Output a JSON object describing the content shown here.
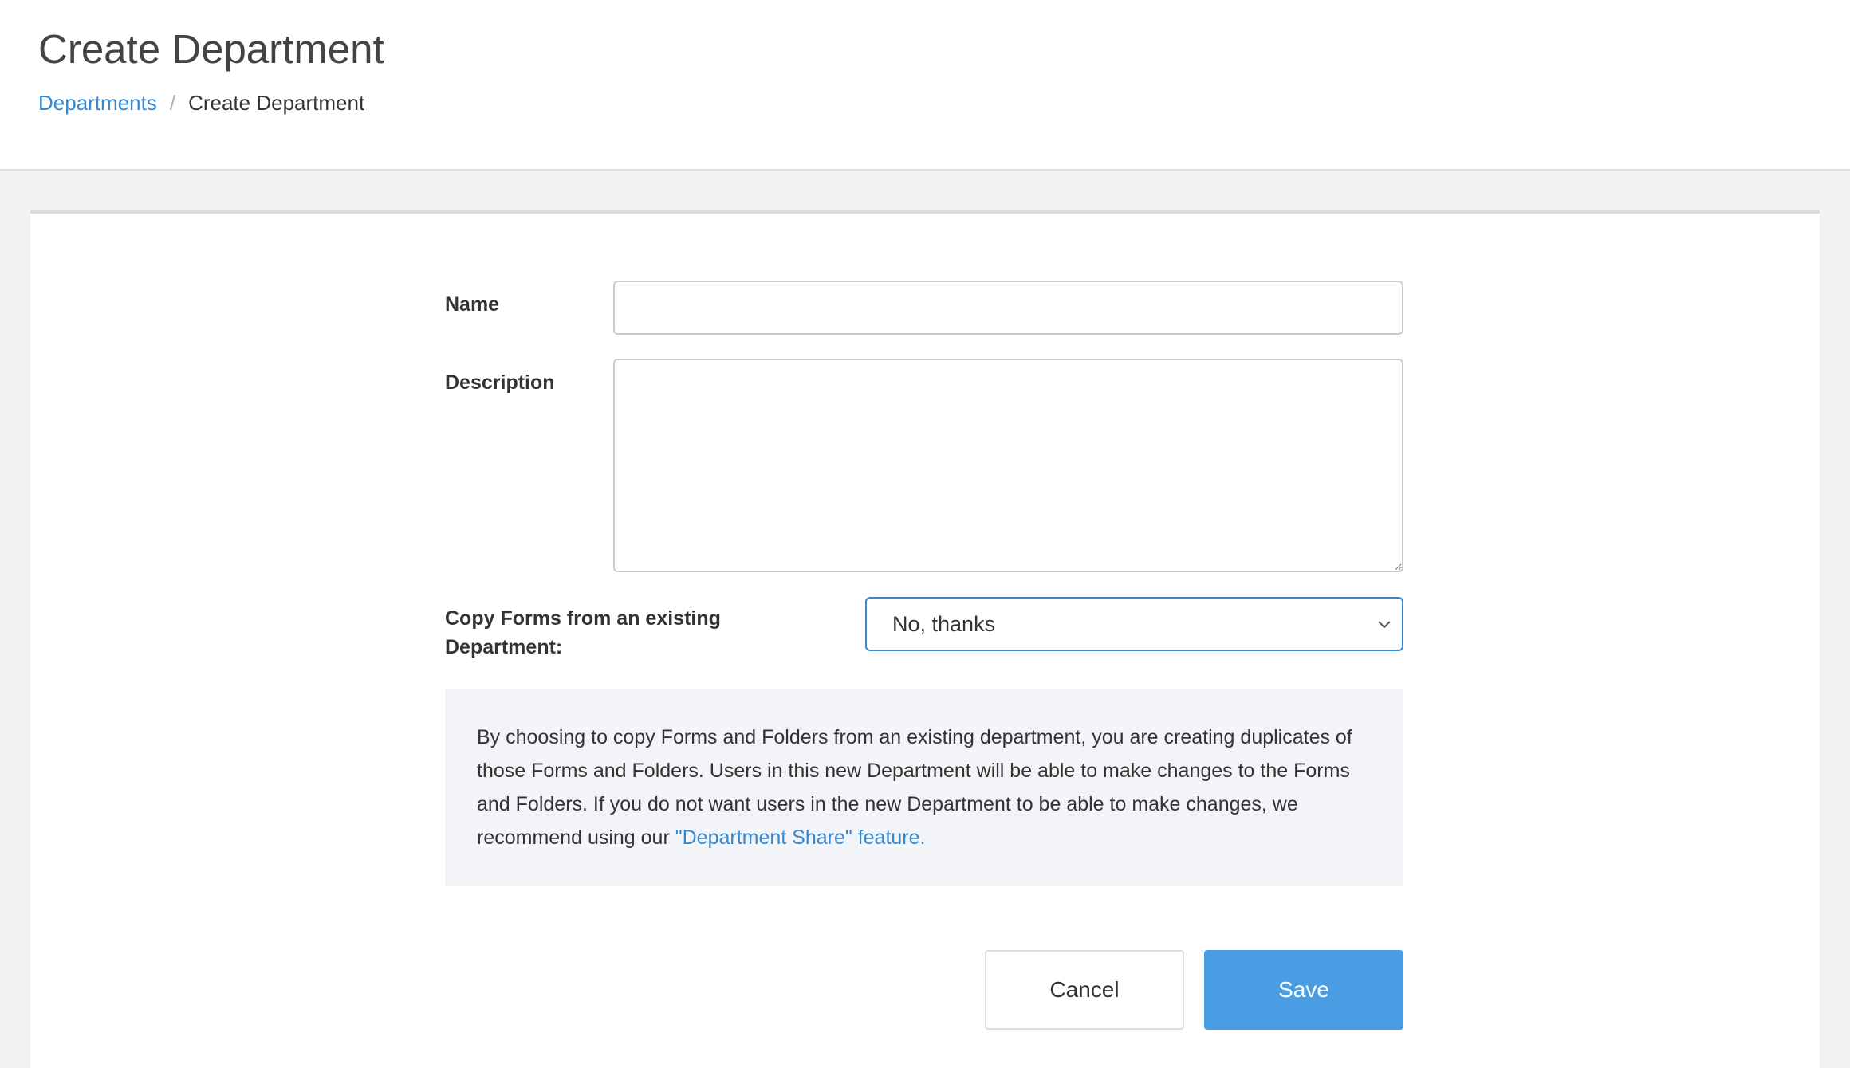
{
  "header": {
    "title": "Create Department",
    "breadcrumb": {
      "parent_label": "Departments",
      "separator": "/",
      "current_label": "Create Department"
    }
  },
  "form": {
    "name": {
      "label": "Name",
      "value": ""
    },
    "description": {
      "label": "Description",
      "value": ""
    },
    "copy_forms": {
      "label": "Copy Forms from an existing Department:",
      "selected": "No, thanks"
    },
    "info": {
      "text": "By choosing to copy Forms and Folders from an existing department, you are creating duplicates of those Forms and Folders. Users in this new Department will be able to make changes to the Forms and Folders. If you do not want users in the new Department to be able to make changes, we recommend using our ",
      "link_text": "\"Department Share\" feature."
    },
    "buttons": {
      "cancel_label": "Cancel",
      "save_label": "Save"
    }
  },
  "colors": {
    "accent": "#3589d3",
    "save_button": "#4a9de3",
    "info_background": "#f2f4f7",
    "page_background": "#f2f2f2"
  }
}
